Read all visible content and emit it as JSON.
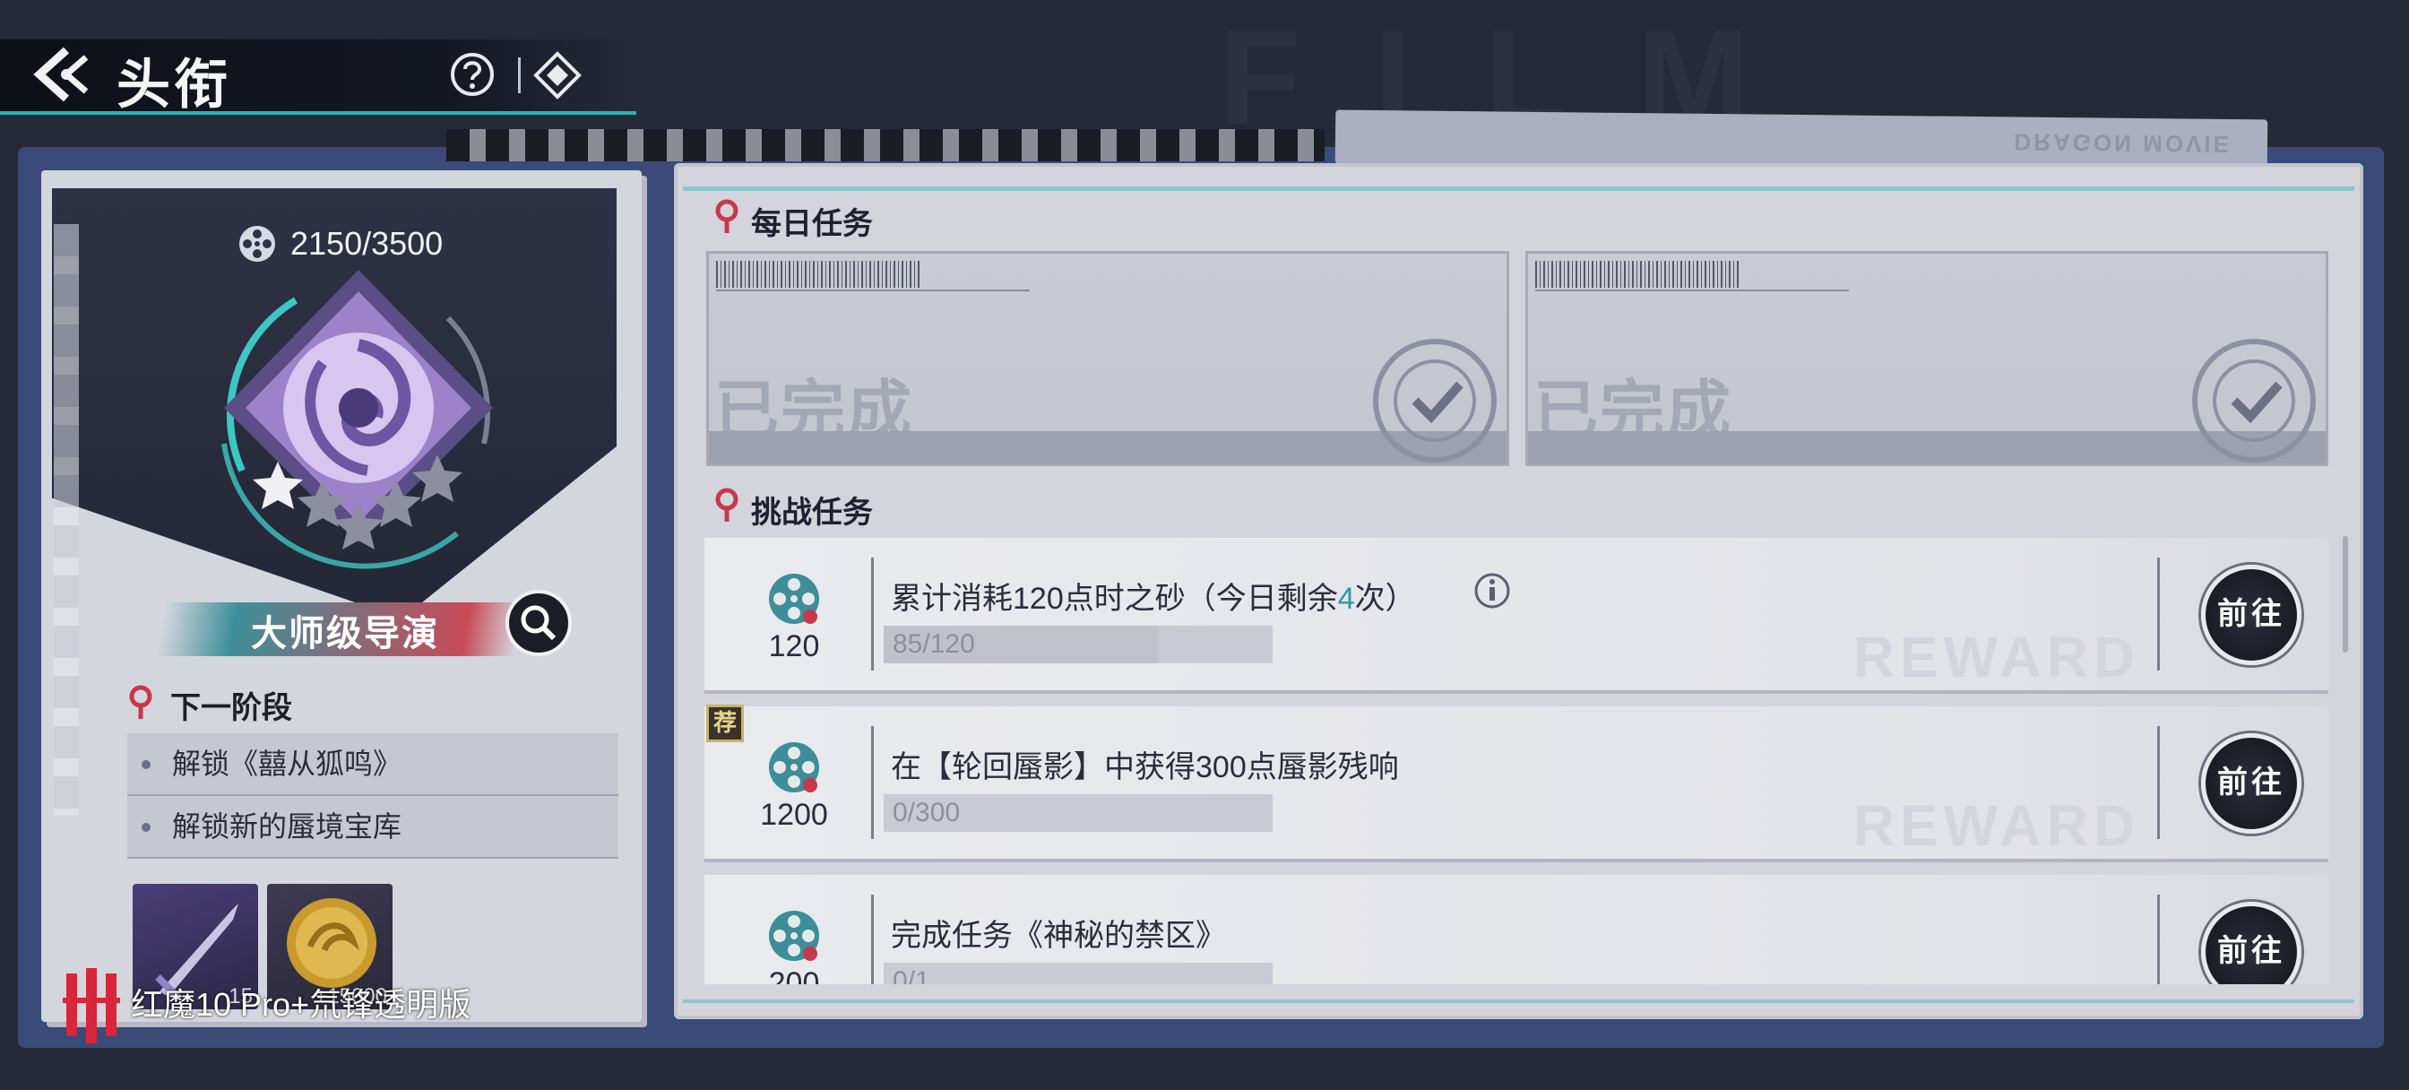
{
  "header": {
    "title": "头衔"
  },
  "frame": {
    "tab_text": "DRAGON MOVIE"
  },
  "profile": {
    "progress": "2150/3500",
    "rank_title": "大师级导演",
    "next_stage_label": "下一阶段",
    "unlocks": [
      "解锁《囍从狐鸣》",
      "解锁新的蜃境宝库"
    ],
    "rewards": [
      {
        "icon": "sword-icon",
        "count": "15"
      },
      {
        "icon": "gold-coin-icon",
        "count": "+15000"
      }
    ]
  },
  "daily": {
    "label": "每日任务",
    "cards": [
      {
        "status": "已完成"
      },
      {
        "status": "已完成"
      }
    ]
  },
  "challenge": {
    "label": "挑战任务",
    "tasks": [
      {
        "reward": "120",
        "title_pre": "累计消耗120点时之砂（今日剩余",
        "title_hl": "4",
        "title_post": "次）",
        "progress": "85/120",
        "fraction": 0.708,
        "go": "前往",
        "recommended": false
      },
      {
        "reward": "1200",
        "title_pre": "在【轮回蜃影】中获得300点蜃影残响",
        "title_hl": "",
        "title_post": "",
        "progress": "0/300",
        "fraction": 0,
        "go": "前往",
        "recommended": true
      },
      {
        "reward": "200",
        "title_pre": "完成任务《神秘的禁区》",
        "title_hl": "",
        "title_post": "",
        "progress": "0/1",
        "fraction": 0,
        "go": "前往",
        "recommended": false
      }
    ],
    "recommend_badge": "荐",
    "reward_ghost": "REWARD"
  },
  "watermark": {
    "text": "红魔10 Pro+氘锋透明版"
  },
  "colors": {
    "accent_teal": "#2bb3b3",
    "accent_red": "#c84b57",
    "highlight": "#2a9aa6"
  }
}
